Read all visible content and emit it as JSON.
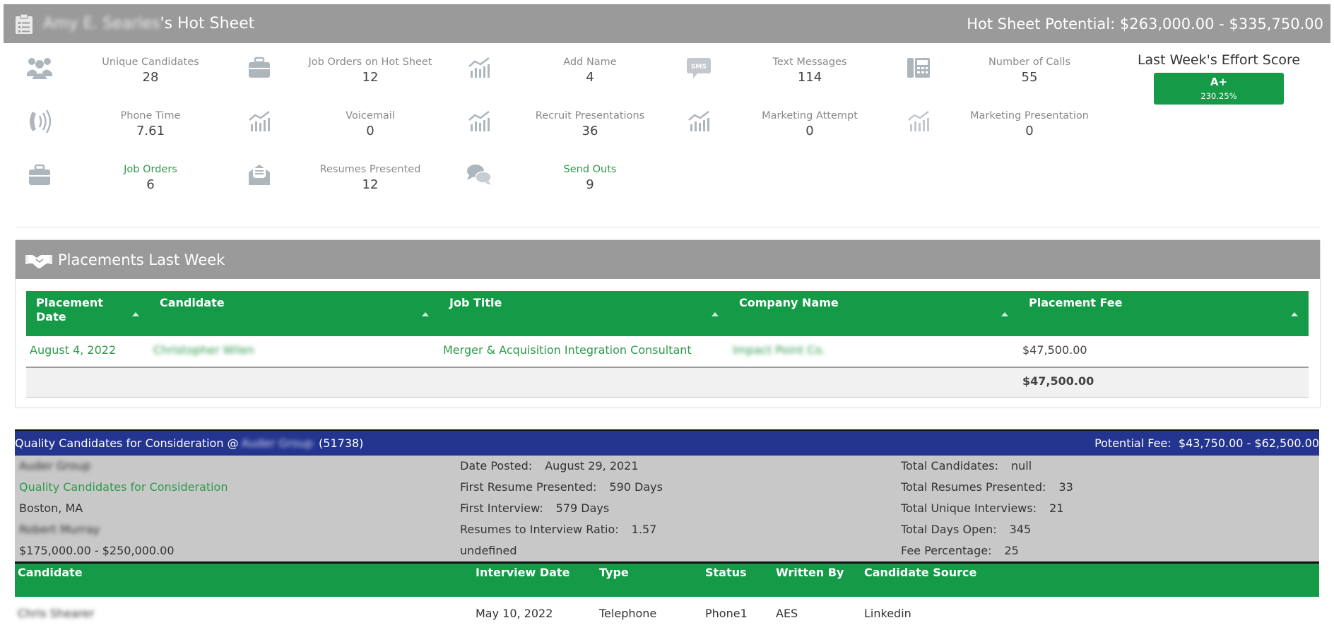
{
  "header": {
    "owner": "Amy E. Searles",
    "title_suffix": "'s Hot Sheet",
    "potential": "Hot Sheet Potential: $263,000.00 - $335,750.00"
  },
  "stats": [
    {
      "label": "Unique Candidates",
      "value": "28",
      "icon": "people-icon"
    },
    {
      "label": "Job Orders on Hot Sheet",
      "value": "12",
      "icon": "briefcase-icon"
    },
    {
      "label": "Add Name",
      "value": "4",
      "icon": "chart-icon"
    },
    {
      "label": "Text Messages",
      "value": "114",
      "icon": "sms-icon"
    },
    {
      "label": "Number of Calls",
      "value": "55",
      "icon": "fax-phone-icon"
    },
    {
      "label": "Phone Time",
      "value": "7.61",
      "icon": "phone-ringing-icon"
    },
    {
      "label": "Voicemail",
      "value": "0",
      "icon": "chart-icon"
    },
    {
      "label": "Recruit Presentations",
      "value": "36",
      "icon": "chart-icon"
    },
    {
      "label": "Marketing Attempt",
      "value": "0",
      "icon": "chart-icon"
    },
    {
      "label": "Marketing Presentation",
      "value": "0",
      "icon": "chart-icon"
    },
    {
      "label": "Job Orders",
      "value": "6",
      "icon": "briefcase-icon"
    },
    {
      "label": "Resumes Presented",
      "value": "12",
      "icon": "envelope-open-icon"
    },
    {
      "label": "Send Outs",
      "value": "9",
      "icon": "chat-bubbles-icon"
    }
  ],
  "effort": {
    "title": "Last Week's Effort Score",
    "grade": "A+",
    "percent": "230.25%",
    "color": "#159a47"
  },
  "placements": {
    "title": "Placements Last Week",
    "columns": [
      "Placement Date",
      "Candidate",
      "Job Title",
      "Company Name",
      "Placement Fee"
    ],
    "rows": [
      {
        "date": "August 4, 2022",
        "candidate": "Christopher Wilen",
        "job_title": "Merger & Acquisition Integration Consultant",
        "company": "Impact Point Co.",
        "fee": "$47,500.00"
      }
    ],
    "total": "$47,500.00"
  },
  "job_order": {
    "title": "Quality Candidates for Consideration @",
    "company": "Auder Group",
    "id": "(51738)",
    "potential_fee_label": "Potential Fee:",
    "potential_fee": "$43,750.00 - $62,500.00",
    "left": {
      "client": "Auder Group",
      "link": "Quality Candidates for Consideration",
      "location": "Boston, MA",
      "contact": "Robert Murray",
      "salary": "$175,000.00 - $250,000.00"
    },
    "middle": [
      {
        "k": "Date Posted:",
        "v": "August 29, 2021"
      },
      {
        "k": "First Resume Presented:",
        "v": "590 Days"
      },
      {
        "k": "First Interview:",
        "v": "579 Days"
      },
      {
        "k": "Resumes to Interview Ratio:",
        "v": "1.57"
      },
      {
        "k": "undefined",
        "v": ""
      }
    ],
    "right": [
      {
        "k": "Total Candidates:",
        "v": "null"
      },
      {
        "k": "Total Resumes Presented:",
        "v": "33"
      },
      {
        "k": "Total Unique Interviews:",
        "v": "21"
      },
      {
        "k": "Total Days Open:",
        "v": "345"
      },
      {
        "k": "Fee Percentage:",
        "v": "25"
      }
    ]
  },
  "candidates": {
    "columns": [
      "Candidate",
      "Interview Date",
      "Type",
      "Status",
      "Written By",
      "Candidate Source"
    ],
    "rows": [
      {
        "candidate": "Chris Shearer",
        "date": "May 10, 2022",
        "type": "Telephone",
        "status": "Phone1",
        "written_by": "AES",
        "source": "Linkedin"
      }
    ]
  },
  "colors": {
    "header_gray": "#9a9a9a",
    "green": "#159a47",
    "navy": "#24358f",
    "link_green": "#2e9a4c"
  }
}
